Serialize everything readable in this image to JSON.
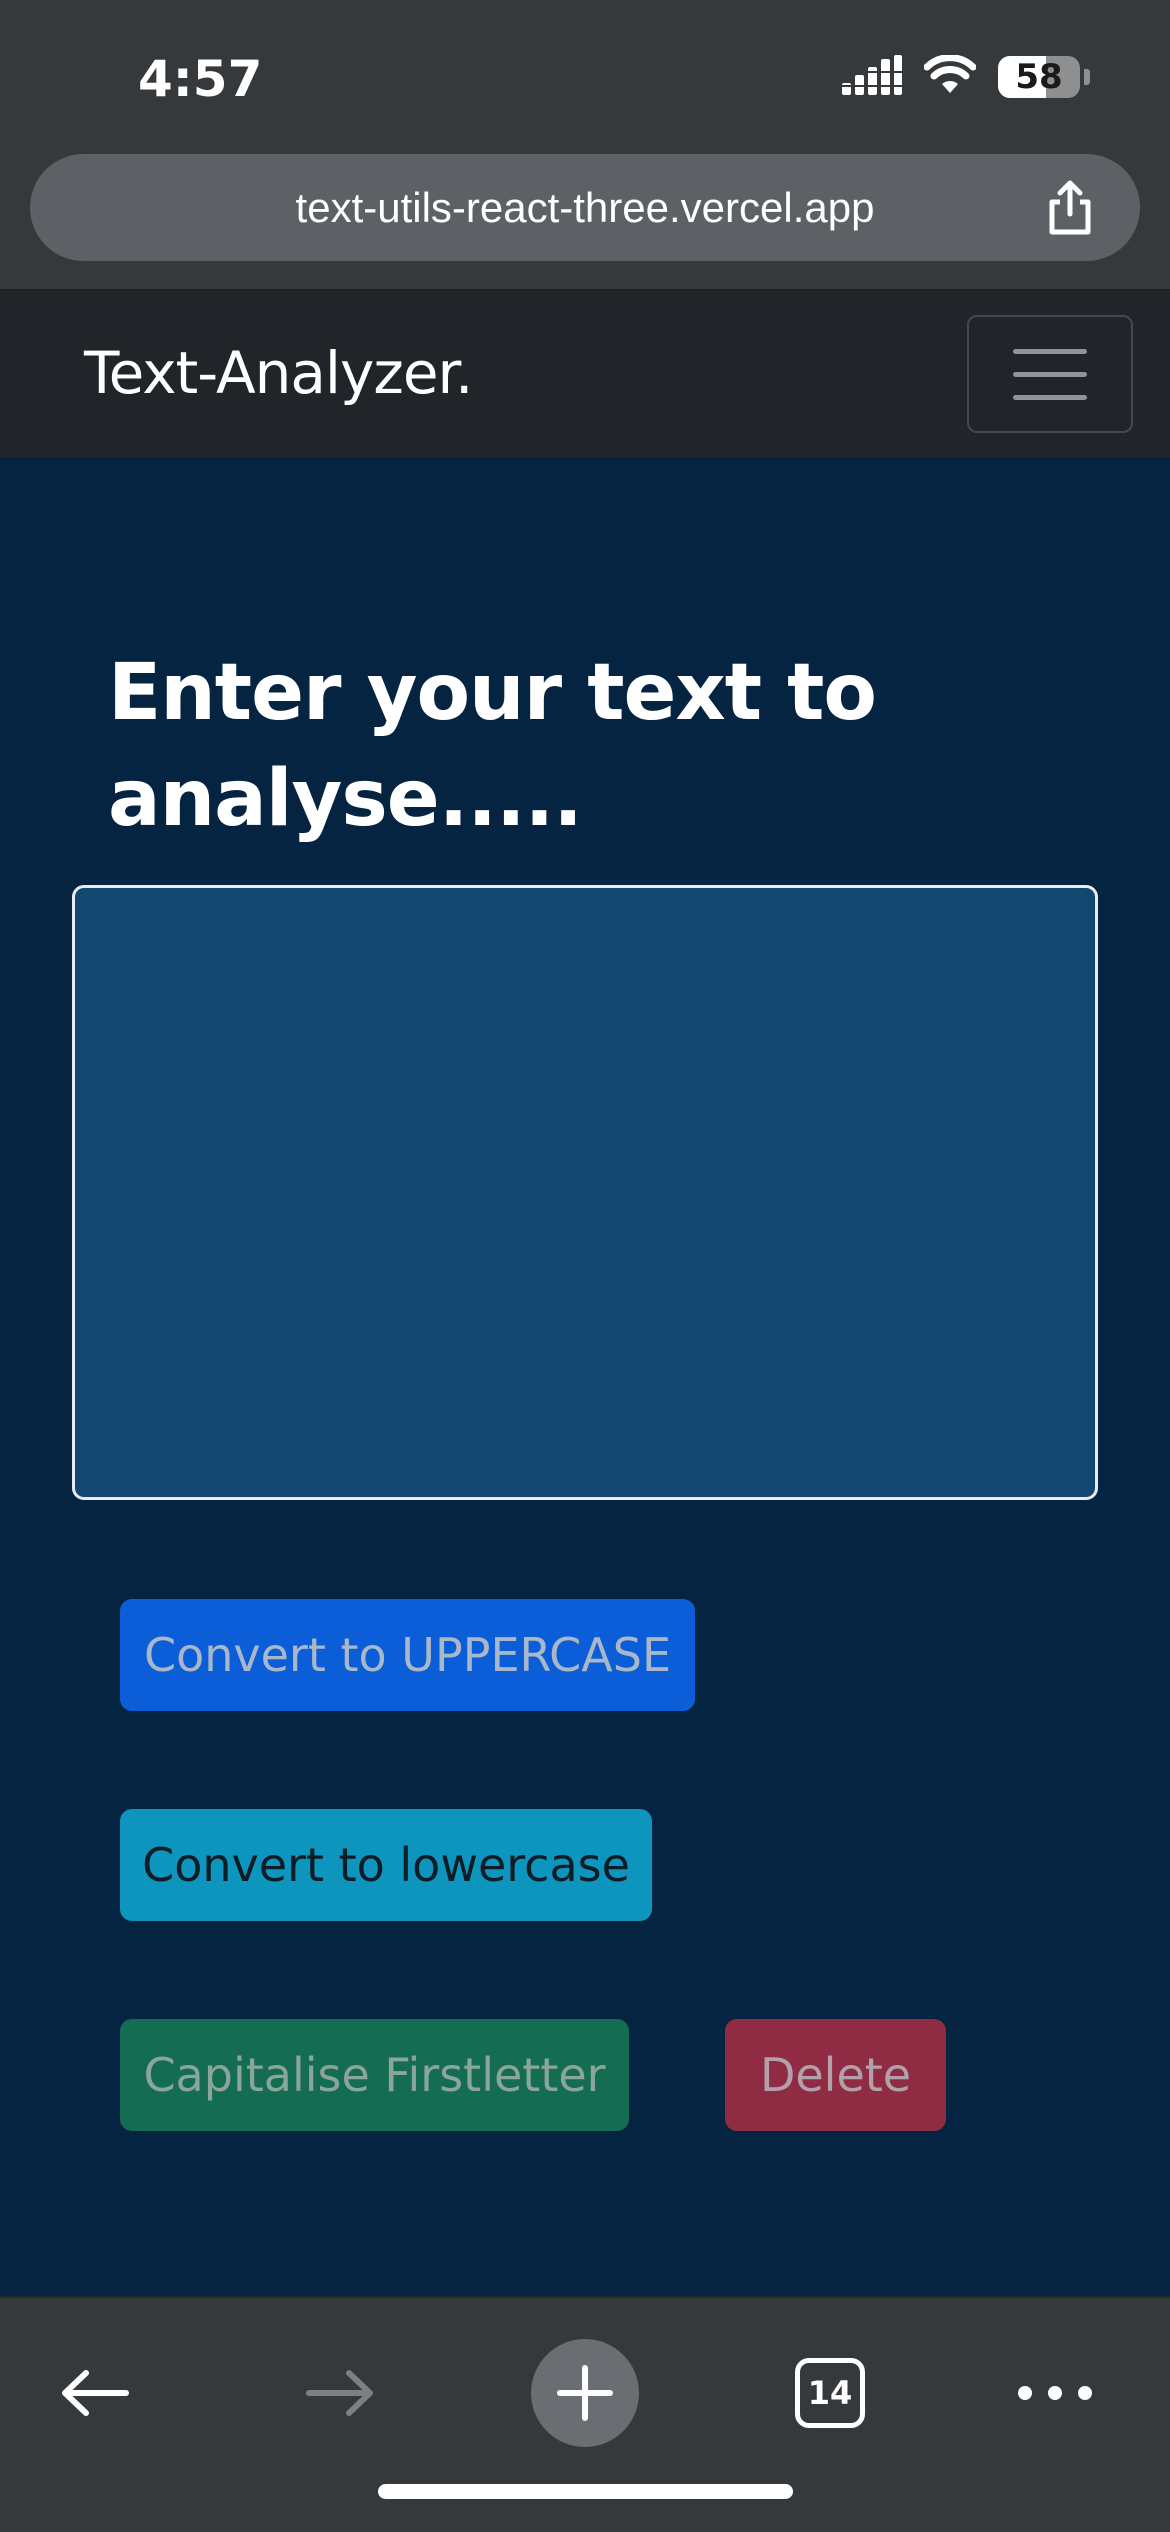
{
  "status_bar": {
    "time": "4:57",
    "battery": "58"
  },
  "browser": {
    "url": "text-utils-react-three.vercel.app",
    "tab_count": "14"
  },
  "navbar": {
    "brand": "Text-Analyzer."
  },
  "main": {
    "heading": "Enter your text to analyse.....",
    "textarea_value": "",
    "buttons": {
      "uppercase": "Convert to UPPERCASE",
      "lowercase": "Convert to lowercase",
      "capitalise": "Capitalise Firstletter",
      "delete": "Delete"
    }
  },
  "colors": {
    "page_bg": "#052442",
    "navbar_bg": "#212529",
    "textarea_bg": "#134670",
    "primary": "#0b5ed7",
    "info": "#0d95bd",
    "success": "#146c52",
    "danger": "#8f2c43"
  },
  "icons": {
    "signal": "cellular-signal-icon",
    "wifi": "wifi-icon",
    "battery": "battery-icon",
    "share": "share-icon",
    "menu": "hamburger-menu-icon",
    "back": "arrow-left-icon",
    "forward": "arrow-right-icon",
    "new_tab": "plus-icon",
    "tabs": "tabs-icon",
    "more": "more-dots-icon"
  }
}
